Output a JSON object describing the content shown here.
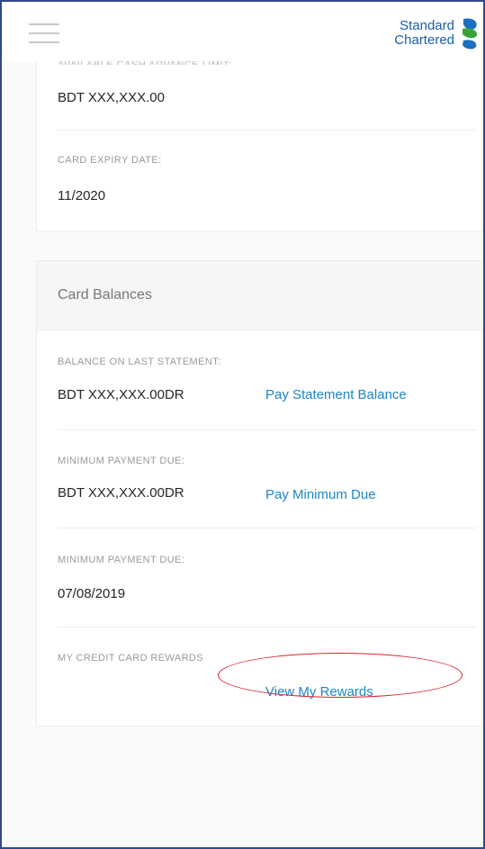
{
  "header": {
    "menu_icon": "hamburger-menu-icon",
    "logo_line1": "Standard",
    "logo_line2": "Chartered",
    "logo_icon": "standard-chartered-logo-icon"
  },
  "card_info": {
    "cut_label": "AVAILABLE CASH ADVANCE LIMIT:",
    "available_value": "BDT XXX,XXX.00",
    "expiry_label": "CARD EXPIRY DATE:",
    "expiry_value": "11/2020"
  },
  "balances": {
    "title": "Card Balances",
    "last_statement_label": "BALANCE ON LAST STATEMENT:",
    "last_statement_value": "BDT XXX,XXX.00DR",
    "pay_statement_link": "Pay Statement Balance",
    "min_due_label": "MINIMUM PAYMENT DUE:",
    "min_due_value": "BDT XXX,XXX.00DR",
    "pay_min_link": "Pay Minimum Due",
    "min_due_date_label": "MINIMUM PAYMENT DUE:",
    "min_due_date_value": "07/08/2019",
    "rewards_label": "MY CREDIT CARD REWARDS",
    "rewards_link": "View My Rewards"
  },
  "colors": {
    "frame_border": "#2f4a8c",
    "link": "#1b87c9",
    "brand_blue": "#1b5fa8",
    "brand_green": "#3aa335",
    "highlight": "#d9262e"
  }
}
